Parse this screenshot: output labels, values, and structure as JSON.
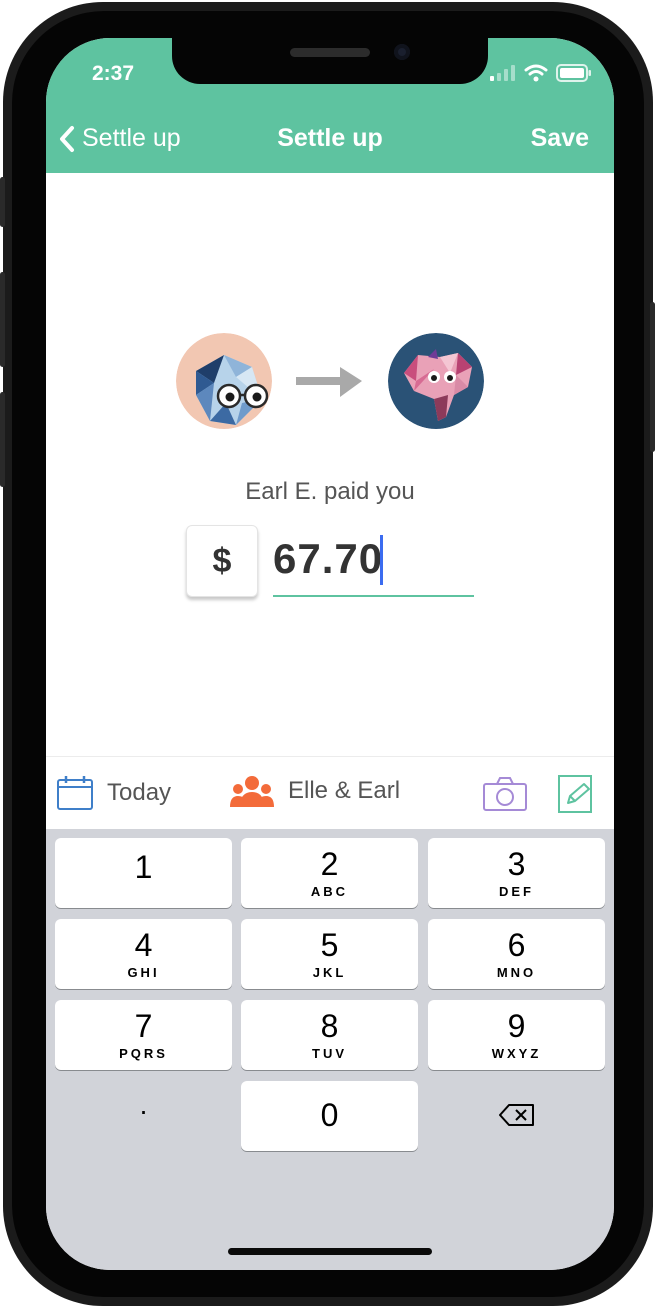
{
  "status_bar": {
    "time": "2:37"
  },
  "nav": {
    "back_label": "Settle up",
    "title": "Settle up",
    "save_label": "Save"
  },
  "payment": {
    "description": "Earl E. paid you",
    "currency_symbol": "$",
    "amount": "67.70"
  },
  "toolbar": {
    "date_label": "Today",
    "group_label": "Elle & Earl"
  },
  "keypad": {
    "keys": [
      {
        "digit": "1",
        "letters": ""
      },
      {
        "digit": "2",
        "letters": "ABC"
      },
      {
        "digit": "3",
        "letters": "DEF"
      },
      {
        "digit": "4",
        "letters": "GHI"
      },
      {
        "digit": "5",
        "letters": "JKL"
      },
      {
        "digit": "6",
        "letters": "MNO"
      },
      {
        "digit": "7",
        "letters": "PQRS"
      },
      {
        "digit": "8",
        "letters": "TUV"
      },
      {
        "digit": "9",
        "letters": "WXYZ"
      }
    ],
    "decimal": ".",
    "zero": "0"
  },
  "colors": {
    "accent": "#5ec3a0",
    "toolbar_orange": "#f36b3a",
    "camera_purple": "#a58ad6",
    "calendar_blue": "#3f7fc9",
    "caret_blue": "#3b6cf0"
  },
  "icons": [
    "back-chevron-icon",
    "signal-icon",
    "wifi-icon",
    "battery-icon",
    "calendar-icon",
    "group-icon",
    "camera-icon",
    "note-edit-icon",
    "backspace-icon"
  ]
}
